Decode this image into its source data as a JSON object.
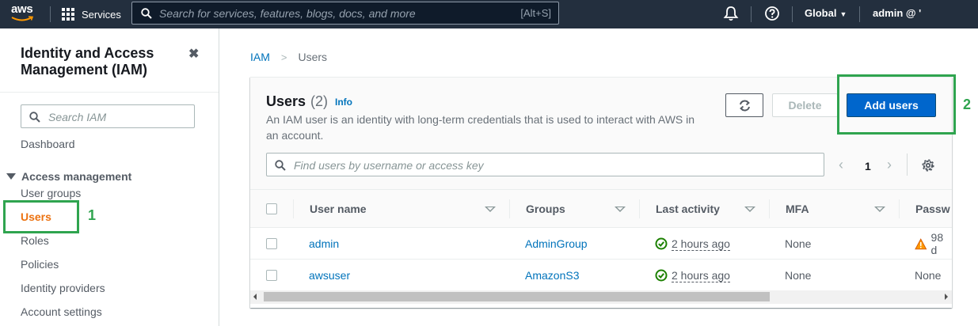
{
  "topnav": {
    "logo": "aws",
    "services_label": "Services",
    "search_placeholder": "Search for services, features, blogs, docs, and more",
    "search_shortcut": "[Alt+S]",
    "region": "Global",
    "account": "admin @ '",
    "icons": [
      "grid-icon",
      "search-icon",
      "bell-icon",
      "help-icon",
      "caret-down-icon"
    ],
    "background": "#232f3e"
  },
  "sidebar": {
    "title": "Identity and Access Management (IAM)",
    "close_symbol": "✖",
    "search_placeholder": "Search IAM",
    "dashboard": "Dashboard",
    "section": "Access management",
    "items": [
      {
        "label": "User groups",
        "active": false
      },
      {
        "label": "Users",
        "active": true
      },
      {
        "label": "Roles",
        "active": false
      },
      {
        "label": "Policies",
        "active": false
      },
      {
        "label": "Identity providers",
        "active": false
      },
      {
        "label": "Account settings",
        "active": false
      }
    ],
    "active_color": "#ec7211"
  },
  "annotations": {
    "step1": "1",
    "step2": "2",
    "color": "#2fa44f"
  },
  "breadcrumb": {
    "root": "IAM",
    "separator": ">",
    "current": "Users"
  },
  "users_panel": {
    "title": "Users",
    "count": "(2)",
    "info": "Info",
    "description": "An IAM user is an identity with long-term credentials that is used to interact with AWS in an account.",
    "delete_label": "Delete",
    "add_label": "Add users",
    "filter_placeholder": "Find users by username or access key",
    "pagination": {
      "prev": "‹",
      "page": "1",
      "next": "›"
    },
    "columns": [
      "User name",
      "Groups",
      "Last activity",
      "MFA",
      "Passw"
    ],
    "rows": [
      {
        "user_name": "admin",
        "groups": "AdminGroup",
        "last_activity": "2 hours ago",
        "mfa": "None",
        "password": "98 d",
        "password_warning": true
      },
      {
        "user_name": "awsuser",
        "groups": "AmazonS3",
        "last_activity": "2 hours ago",
        "mfa": "None",
        "password": "None",
        "password_warning": false
      }
    ],
    "primary_color": "#0066cc",
    "link_color": "#0073bb"
  }
}
